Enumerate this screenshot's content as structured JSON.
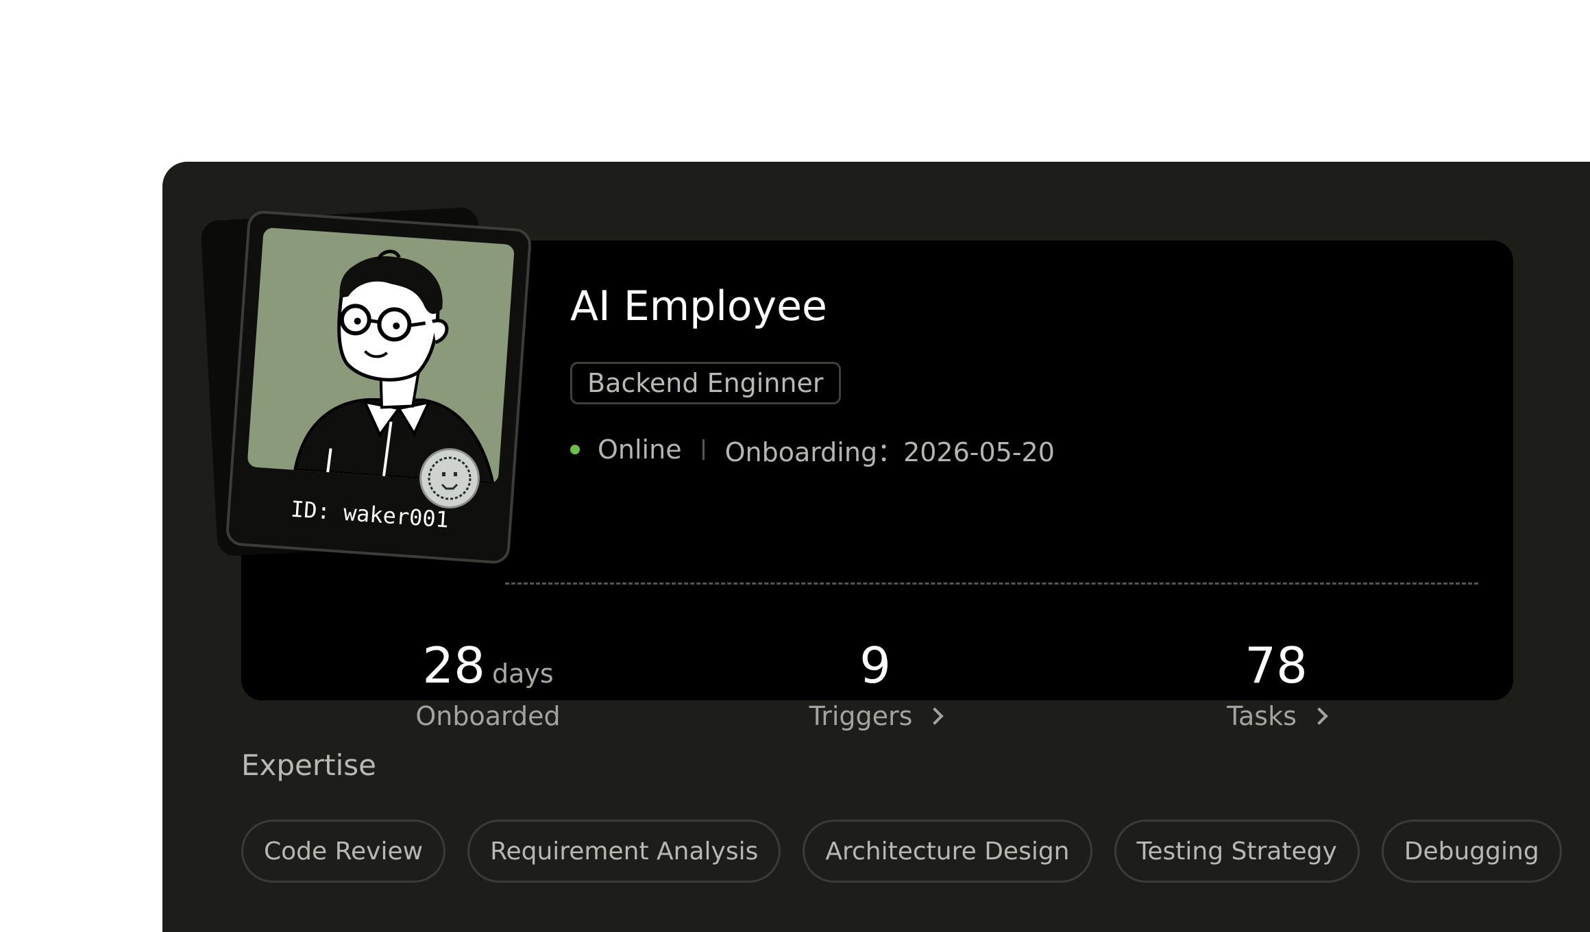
{
  "profile": {
    "name": "AI Employee",
    "role": "Backend Enginner",
    "status": "Online",
    "onboarding": "Onboarding：2026-05-20",
    "badge_id": "ID: waker001",
    "status_color": "#6cc04a"
  },
  "stats": {
    "onboarded": {
      "value": "28",
      "unit": "days",
      "label": "Onboarded"
    },
    "triggers": {
      "value": "9",
      "label": "Triggers"
    },
    "tasks": {
      "value": "78",
      "label": "Tasks"
    }
  },
  "expertise": {
    "title": "Expertise",
    "tags": [
      "Code Review",
      "Requirement Analysis",
      "Architecture Design",
      "Testing Strategy",
      "Debugging"
    ]
  },
  "icons": {
    "avatar": "cartoon-person-with-glasses",
    "seal": "smiley-face-seal",
    "chevron": "chevron-right-icon"
  }
}
